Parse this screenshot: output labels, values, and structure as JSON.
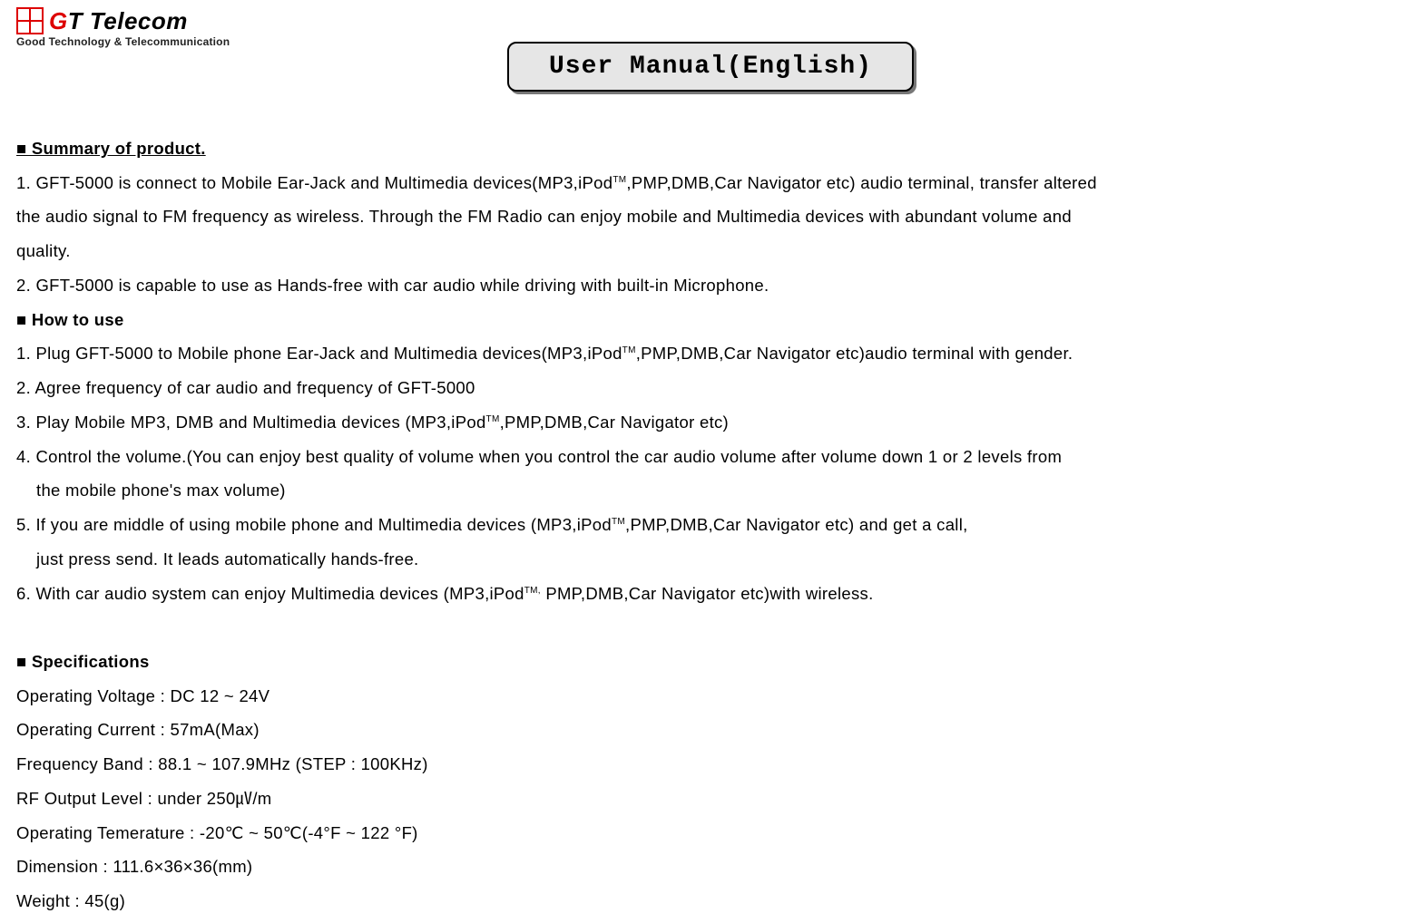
{
  "logo": {
    "name": "GT Telecom",
    "tagline": "Good Technology & Telecommunication"
  },
  "title": "User Manual(English)",
  "sections": {
    "summary": {
      "heading": "■ Summary of product.",
      "p1_a": "1. GFT-5000 is connect to Mobile Ear-Jack and Multimedia devices(MP3,iPod",
      "p1_b": ",PMP,DMB,Car Navigator etc) audio terminal, transfer altered",
      "p1_c": "the audio signal to FM frequency as wireless. Through the FM Radio can enjoy mobile and Multimedia devices with abundant volume and",
      "p1_d": "quality.",
      "p2": "2. GFT-5000 is capable to use as Hands-free with car audio while driving with built-in Microphone."
    },
    "howto": {
      "heading": "■ How to use",
      "s1_a": "1. Plug GFT-5000 to Mobile phone Ear-Jack and Multimedia devices(MP3,iPod",
      "s1_b": ",PMP,DMB,Car Navigator etc)audio terminal with gender.",
      "s2": "2. Agree frequency of car audio and frequency of GFT-5000",
      "s3_a": "3. Play Mobile MP3, DMB and Multimedia devices (MP3,iPod",
      "s3_b": ",PMP,DMB,Car Navigator etc)",
      "s4_a": "4. Control the volume.(You can enjoy best quality of volume when you control the car audio volume after volume down 1 or 2 levels from",
      "s4_b": "the mobile phone's max volume)",
      "s5_a": "5. If you are middle of using mobile phone and Multimedia devices (MP3,iPod",
      "s5_b": ",PMP,DMB,Car Navigator etc) and get a call,",
      "s5_c": "just  press send. It leads automatically hands-free.",
      "s6_a": "6. With car audio system can enjoy Multimedia devices (MP3,iPod",
      "s6_b": " PMP,DMB,Car Navigator etc)with wireless."
    },
    "specs": {
      "heading": "■ Specifications",
      "r1": "Operating Voltage : DC 12 ~ 24V",
      "r2": "Operating Current : 57mA(Max)",
      "r3": "Frequency Band  : 88.1 ~ 107.9MHz (STEP : 100KHz)",
      "r4": "RF Output Level : under 250㎶/m",
      "r5": "Operating Temerature : -20℃ ~ 50℃(-4°F ~ 122 °F)",
      "r6": "Dimension : 111.6×36×36(mm)",
      "r7": "Weight : 45(g)"
    }
  },
  "tm": "TM",
  "tm_comma": "TM,"
}
